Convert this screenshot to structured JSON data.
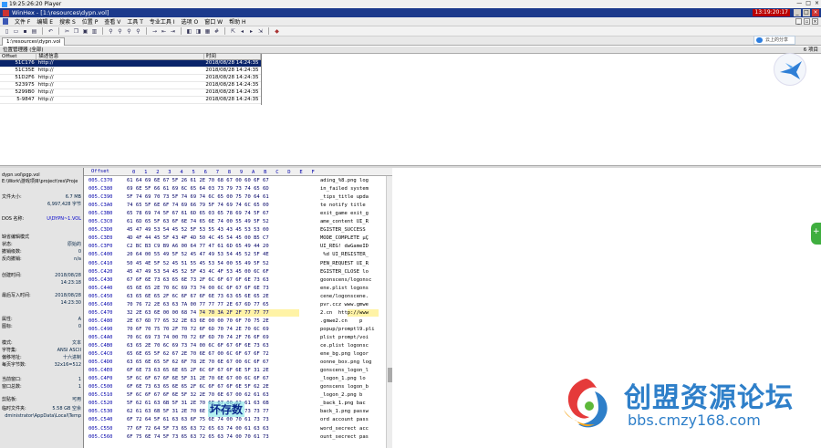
{
  "player": {
    "title": "19:25:26:20 Player",
    "controls": [
      "—",
      "□",
      "×"
    ]
  },
  "window": {
    "title": "WinHex - [1:\\resources\\dypn.vol]",
    "clock": "13:19:20:17",
    "controls": [
      "_",
      "□",
      "×"
    ]
  },
  "menu": {
    "items": [
      "文件 F",
      "编辑 E",
      "搜索 S",
      "位置 P",
      "查看 V",
      "工具 T",
      "专业工具 I",
      "选项 O",
      "窗口 W",
      "帮助 H"
    ]
  },
  "toolbar": {
    "icons": [
      "new-icon",
      "open-icon",
      "save-icon",
      "print-icon",
      "undo-icon",
      "cut-icon",
      "copy-icon",
      "paste-icon",
      "find-icon",
      "replace-icon",
      "find-hex-icon",
      "goto-icon",
      "back-icon",
      "forward-icon",
      "disk-icon",
      "ram-icon",
      "calc-icon",
      "hash-icon",
      "nav-first-icon",
      "nav-prev-icon",
      "nav-next-icon",
      "nav-last-icon",
      "help-icon"
    ]
  },
  "tab": {
    "label": "1:\\resources\\dypn.vol"
  },
  "snapshot_panel": {
    "header": "位置管理器 (全部)",
    "count": "6 项目",
    "columns": [
      "Offset",
      "描述信息",
      "时间"
    ],
    "rows": [
      {
        "offset": "51C176",
        "desc": "http://",
        "time": "2018/08/28  14:24:35",
        "selected": true
      },
      {
        "offset": "51C35E",
        "desc": "http://",
        "time": "2018/08/28  14:24:35",
        "selected": false
      },
      {
        "offset": "51D2F6",
        "desc": "http://",
        "time": "2018/08/28  14:24:35",
        "selected": false
      },
      {
        "offset": "523975",
        "desc": "http://",
        "time": "2018/08/28  14:24:35",
        "selected": false
      },
      {
        "offset": "5299B0",
        "desc": "http://",
        "time": "2018/08/28  14:24:35",
        "selected": false
      },
      {
        "offset": "5-9847",
        "desc": "http://",
        "time": "2018/08/28  14:24:35",
        "selected": false
      }
    ]
  },
  "cloud_badge": "云上的分享",
  "info_panel": {
    "path_title": "dypn.vol\\pgp.vol",
    "path": "E:\\Work\\游戏项目\\project\\res\\Proje",
    "fields": [
      {
        "k": "文件大小:",
        "v": "6.7 MB"
      },
      {
        "k": "",
        "v": "6,997,428 字节"
      },
      {
        "k": "DOS 名称:",
        "v": "U\\DYPN~1.VOL"
      },
      {
        "k": "缺省编辑模式",
        "v": ""
      },
      {
        "k": "状态:",
        "v": "原始的"
      },
      {
        "k": "撤销级数:",
        "v": "0"
      },
      {
        "k": "反向撤销:",
        "v": "n/a"
      },
      {
        "k": "创建时间:",
        "v": "2018/08/28"
      },
      {
        "k": "",
        "v": "14:23:18"
      },
      {
        "k": "最后写入时间:",
        "v": "2018/08/28"
      },
      {
        "k": "",
        "v": "14:23:30"
      },
      {
        "k": "属性:",
        "v": "A"
      },
      {
        "k": "图标:",
        "v": "0"
      },
      {
        "k": "模式:",
        "v": "文本"
      },
      {
        "k": "字符集:",
        "v": "ANSI ASCII"
      },
      {
        "k": "偏移地址:",
        "v": "十六进制"
      },
      {
        "k": "每页字节数:",
        "v": "32x16=512"
      },
      {
        "k": "当前窗口:",
        "v": "1"
      },
      {
        "k": "窗口总数:",
        "v": "1"
      },
      {
        "k": "剪贴板:",
        "v": "可用"
      },
      {
        "k": "临时文件夹:",
        "v": "5.58 GB 空余"
      },
      {
        "k": "",
        "v": "dministrator\\AppData\\Local\\Temp"
      }
    ]
  },
  "hex_view": {
    "header_label": "Offset",
    "columns": [
      "0",
      "1",
      "2",
      "3",
      "4",
      "5",
      "6",
      "7",
      "8",
      "9",
      "A",
      "B",
      "C",
      "D",
      "E",
      "F"
    ],
    "rows": [
      {
        "off": "005.C370",
        "hex": "61 64 69 6E 67 5F 26 61 2E 70 68 67 00 60 6F 67",
        "txt": "ading_%8.png log"
      },
      {
        "off": "005.C380",
        "hex": "69 6E 5F 66 61 69 6C 65 64 03 73 79 73 74 65 6D",
        "txt": "in_failed system"
      },
      {
        "off": "005.C390",
        "hex": "5F 74 69 70 73 5F 74 69 74 6C 65 00 75 70 64 61",
        "txt": "_tips_title upda"
      },
      {
        "off": "005.C3A0",
        "hex": "74 65 5F 6E 6F 74 69 66 79 5F 74 69 74 6C 65 00",
        "txt": "te notify title "
      },
      {
        "off": "005.C3B0",
        "hex": "65 78 69 74 5F 67 61 6D 65 03 65 78 69 74 5F 67",
        "txt": "exit_game exit_g"
      },
      {
        "off": "005.C3C0",
        "hex": "61 6D 65 5F 63 6F 6E 74 65 6E 74 00 55 49 5F 52",
        "txt": "ame_content UI_R"
      },
      {
        "off": "005.C3D0",
        "hex": "45 47 49 53 54 45 52 5F 53 55 43 43 45 53 53 00",
        "txt": "EGISTER_SUCCESS "
      },
      {
        "off": "005.C3E0",
        "hex": "4D 4F 44 45 5F 43 4F 4D 50 4C 45 54 45 00 B5 C7",
        "txt": "MODE_COMPLETE µÇ"
      },
      {
        "off": "005.C3F0",
        "hex": "C2 BC B3 C9 B9 A6 00 64 77 47 61 6D 65 49 44 20",
        "txt": "UI_REG! dwGameID"
      },
      {
        "off": "005.C400",
        "hex": "20 64 00 55 49 5F 52 45 47 49 53 54 45 52 5F 4E",
        "txt": " %d UI_REGISTER_"
      },
      {
        "off": "005.C410",
        "hex": "50 45 4E 5F 52 45 51 55 45 53 54 00 55 49 5F 52",
        "txt": "PEN_REQUEST UI_R"
      },
      {
        "off": "005.C420",
        "hex": "45 47 49 53 54 45 52 5F 43 4C 4F 53 45 00 6C 6F",
        "txt": "EGISTER_CLOSE lo"
      },
      {
        "off": "005.C430",
        "hex": "67 6F 6E 73 63 65 6E 73 2F 6C 6F 67 6F 6E 73 63",
        "txt": "goonscens/logonsc"
      },
      {
        "off": "005.C440",
        "hex": "65 6E 65 2E 70 6C 69 73 74 00 6C 6F 67 6F 6E 73",
        "txt": "ene.plist logons"
      },
      {
        "off": "005.C450",
        "hex": "63 65 6E 65 2F 6C 6F 67 6F 6E 73 63 65 6E 65 2E",
        "txt": "cene/logonscene."
      },
      {
        "off": "005.C460",
        "hex": "70 76 72 2E 63 63 7A 00 77 77 77 2E 67 6D 77 65",
        "txt": "pvr.ccz www.gmwe"
      },
      {
        "off": "005.C470",
        "hex": "32 2E 63 6E 00 00 68 74 74 70 3A 2F 2F 77 77 77",
        "txt": "2.cn  http://www"
      },
      {
        "off": "005.C480",
        "hex": "2E 67 6D 77 65 32 2E 63 6E 00 00 70 6F 70 75 2E",
        "txt": ".gmwe2.cn    p"
      },
      {
        "off": "005.C490",
        "hex": "70 6F 70 75 70 2F 70 72 6F 6D 70 74 2E 70 6C 69",
        "txt": "popup/promptl9.pli"
      },
      {
        "off": "005.C4A0",
        "hex": "70 6C 69 73 74 00 70 72 6F 6D 70 74 2F 76 6F 69",
        "txt": "plist prompt/voi"
      },
      {
        "off": "005.C4B0",
        "hex": "63 65 2E 70 6C 69 73 74 00 6C 6F 67 6F 6E 73 63",
        "txt": "ce.plist logonsc"
      },
      {
        "off": "005.C4C0",
        "hex": "65 6E 65 5F 62 67 2E 70 6E 67 00 6C 6F 67 6F 72",
        "txt": "ene_bg.png logor"
      },
      {
        "off": "005.C4D0",
        "hex": "63 65 6E 65 5F 62 6F 78 2E 70 6E 67 00 6C 6F 67",
        "txt": "oonne_box.png log"
      },
      {
        "off": "005.C4E0",
        "hex": "6F 6E 73 63 65 6E 65 2F 6C 6F 67 6F 6E 5F 31 2E",
        "txt": "gonscens_logon_l"
      },
      {
        "off": "005.C4F0",
        "hex": "5F 6C 6F 67 6F 6E 5F 31 2E 70 6E 67 00 6C 6F 67",
        "txt": "_logon_1.png lo"
      },
      {
        "off": "005.C500",
        "hex": "6F 6E 73 63 65 6E 65 2F 6C 6F 67 6F 6E 5F 62 2E",
        "txt": "gonscens logon_b"
      },
      {
        "off": "005.C510",
        "hex": "5F 6C 6F 67 6F 6E 5F 32 2E 70 6E 67 00 62 61 63",
        "txt": "_logon_2.png b"
      },
      {
        "off": "005.C520",
        "hex": "5F 62 61 63 6B 5F 31 2E 70 6E 67 00 62 61 63 6B",
        "txt": "_back_1.png bac"
      },
      {
        "off": "005.C530",
        "hex": "62 61 63 6B 5F 31 2E 70 6E 67 00 70 61 73 73 77",
        "txt": "back_1.png passw"
      },
      {
        "off": "005.C540",
        "hex": "6F 72 64 5F 61 63 63 6F 75 6E 74 00 70 61 73 73",
        "txt": "ord account pass"
      },
      {
        "off": "005.C550",
        "hex": "77 6F 72 64 5F 73 65 63 72 65 63 74 00 61 63 63",
        "txt": "word_secrect acc"
      },
      {
        "off": "005.C560",
        "hex": "6F 75 6E 74 5F 73 65 63 72 65 63 74 00 70 61 73",
        "txt": "ount_secrect pas"
      }
    ],
    "highlight_row": 16
  },
  "cursor_note": "坏存数",
  "watermark": {
    "title": "创盟资源论坛",
    "url": "bbs.cmzy168.com"
  }
}
